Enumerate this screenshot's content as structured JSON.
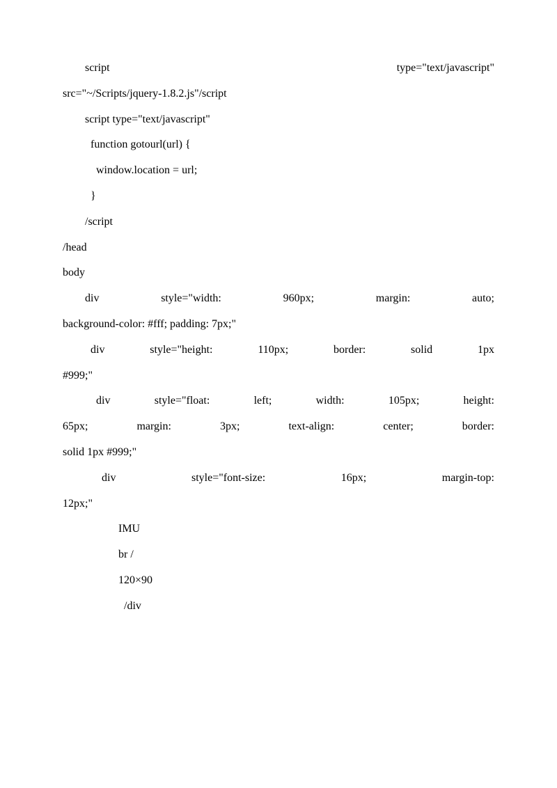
{
  "document": {
    "lines": [
      {
        "cls": "line indent-1",
        "text": "script                type=\"text/javascript\""
      },
      {
        "cls": "line-left noindent",
        "text": "src=\"~/Scripts/jquery-1.8.2.js\"/script"
      },
      {
        "cls": "line-left indent-1",
        "text": "script type=\"text/javascript\""
      },
      {
        "cls": "line-left indent-2",
        "text": "function gotourl(url) {"
      },
      {
        "cls": "line-left indent-3",
        "text": "window.location = url;"
      },
      {
        "cls": "line-left indent-2",
        "text": "}"
      },
      {
        "cls": "line-left indent-1",
        "text": "/script"
      },
      {
        "cls": "line-left",
        "text": " /head"
      },
      {
        "cls": "line-left",
        "text": " body"
      },
      {
        "cls": "line indent-1",
        "text": "div   style=\"width:   960px;   margin:   auto;"
      },
      {
        "cls": "line-left noindent cont",
        "text": "background-color: #fff; padding: 7px;\""
      },
      {
        "cls": "line indent-2",
        "text": "div  style=\"height:  110px;  border:  solid  1px"
      },
      {
        "cls": "line-left noindent cont",
        "text": "#999;\""
      },
      {
        "cls": "line indent-3",
        "text": "div style=\"float: left; width: 105px; height:"
      },
      {
        "cls": "line noindent",
        "text": "65px;  margin:  3px;  text-align:  center;  border:"
      },
      {
        "cls": "line-left noindent cont",
        "text": "solid 1px #999;\""
      },
      {
        "cls": "line indent-4",
        "text": "div   style=\"font-size:   16px;   margin-top:"
      },
      {
        "cls": "line-left noindent cont",
        "text": "12px;\""
      },
      {
        "cls": "line-left indent-5",
        "text": "IMU"
      },
      {
        "cls": "line-left indent-5",
        "text": "br /"
      },
      {
        "cls": "line-left indent-5",
        "text": "120×90"
      },
      {
        "cls": "line-left indent-6",
        "text": "/div"
      }
    ]
  }
}
